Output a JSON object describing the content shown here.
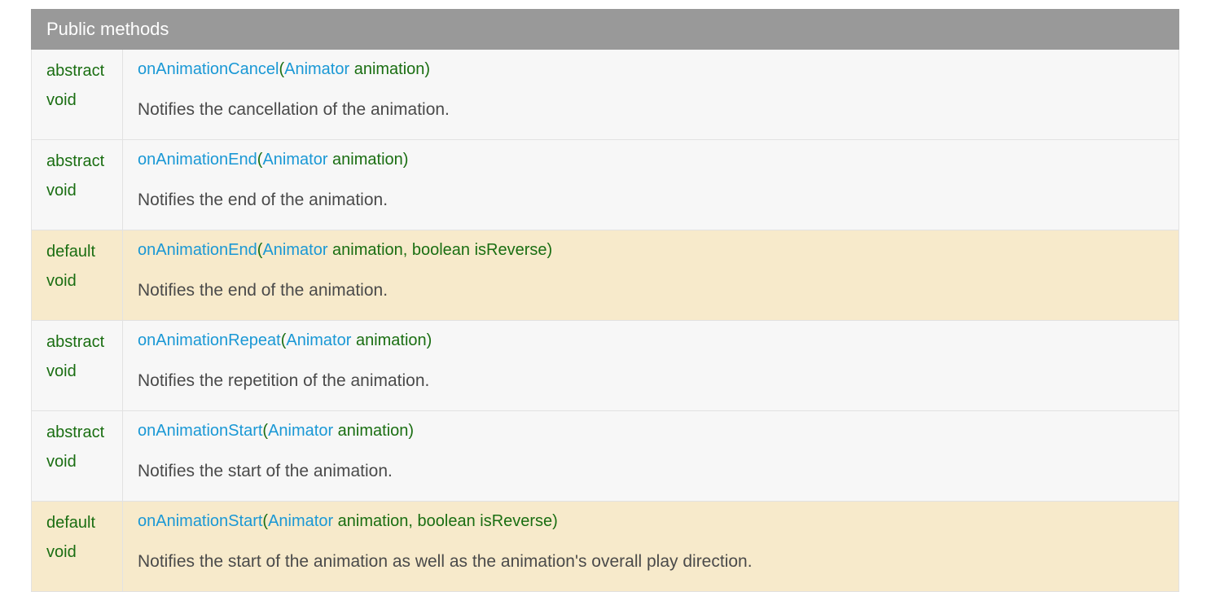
{
  "section": {
    "title": "Public methods"
  },
  "methods": [
    {
      "modifier": [
        "abstract",
        "void"
      ],
      "name": "onAnimationCancel",
      "open": "(",
      "param_type": "Animator",
      "param_rest": " animation)",
      "description": "Notifies the cancellation of the animation.",
      "kind": "abstract"
    },
    {
      "modifier": [
        "abstract",
        "void"
      ],
      "name": "onAnimationEnd",
      "open": "(",
      "param_type": "Animator",
      "param_rest": " animation)",
      "description": "Notifies the end of the animation.",
      "kind": "abstract"
    },
    {
      "modifier": [
        "default",
        "void"
      ],
      "name": "onAnimationEnd",
      "open": "(",
      "param_type": "Animator",
      "param_rest": " animation, boolean isReverse)",
      "description": "Notifies the end of the animation.",
      "kind": "default"
    },
    {
      "modifier": [
        "abstract",
        "void"
      ],
      "name": "onAnimationRepeat",
      "open": "(",
      "param_type": "Animator",
      "param_rest": " animation)",
      "description": "Notifies the repetition of the animation.",
      "kind": "abstract"
    },
    {
      "modifier": [
        "abstract",
        "void"
      ],
      "name": "onAnimationStart",
      "open": "(",
      "param_type": "Animator",
      "param_rest": " animation)",
      "description": "Notifies the start of the animation.",
      "kind": "abstract"
    },
    {
      "modifier": [
        "default",
        "void"
      ],
      "name": "onAnimationStart",
      "open": "(",
      "param_type": "Animator",
      "param_rest": " animation, boolean isReverse)",
      "description": "Notifies the start of the animation as well as the animation's overall play direction.",
      "kind": "default"
    }
  ]
}
